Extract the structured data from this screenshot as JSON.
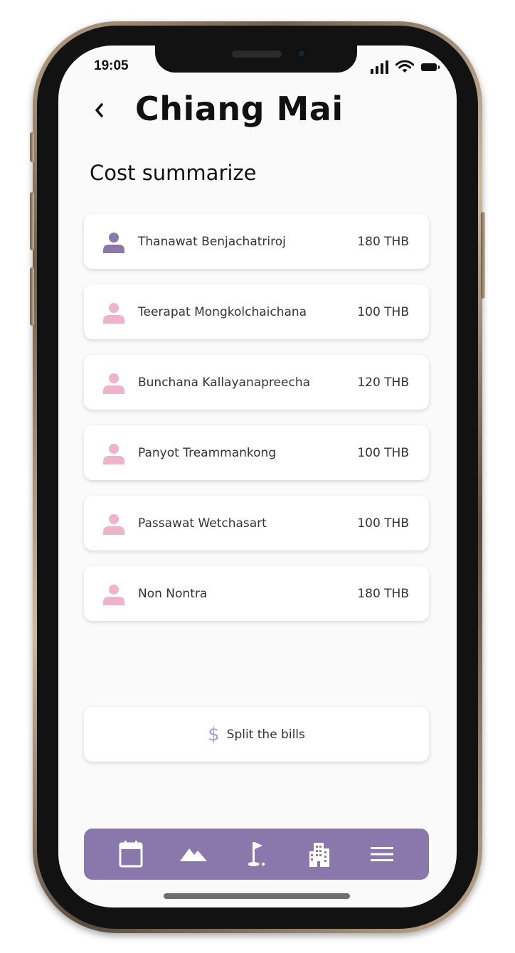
{
  "status_bar": {
    "time": "19:05"
  },
  "header": {
    "back_icon": "chevron-left-icon",
    "title": "Chiang Mai"
  },
  "section": {
    "title": "Cost summarize"
  },
  "members": [
    {
      "name": "Thanawat Benjachatriroj",
      "amount": "180 THB",
      "icon": "person-icon",
      "icon_color": "#8a78ad"
    },
    {
      "name": "Teerapat Mongkolchaichana",
      "amount": "100 THB",
      "icon": "person-icon",
      "icon_color": "#f0b3cc"
    },
    {
      "name": "Bunchana Kallayanapreecha",
      "amount": "120 THB",
      "icon": "person-icon",
      "icon_color": "#f0b3cc"
    },
    {
      "name": "Panyot Treammankong",
      "amount": "100 THB",
      "icon": "person-icon",
      "icon_color": "#f0b3cc"
    },
    {
      "name": "Passawat Wetchasart",
      "amount": "100 THB",
      "icon": "person-icon",
      "icon_color": "#f0b3cc"
    },
    {
      "name": "Non Nontra",
      "amount": "180 THB",
      "icon": "person-icon",
      "icon_color": "#f0b3cc"
    }
  ],
  "split_button": {
    "icon": "dollar-icon",
    "icon_glyph": "$",
    "label": "Split the bills"
  },
  "bottom_nav": {
    "items": [
      {
        "icon": "calendar-icon"
      },
      {
        "icon": "mountain-icon"
      },
      {
        "icon": "golf-flag-icon"
      },
      {
        "icon": "building-icon"
      },
      {
        "icon": "menu-icon"
      }
    ]
  },
  "colors": {
    "accent": "#8a78ad",
    "person_primary": "#8a78ad",
    "person_secondary": "#f0b3cc",
    "dollar": "#b49ad4",
    "background": "#fafafa",
    "card": "#ffffff"
  }
}
